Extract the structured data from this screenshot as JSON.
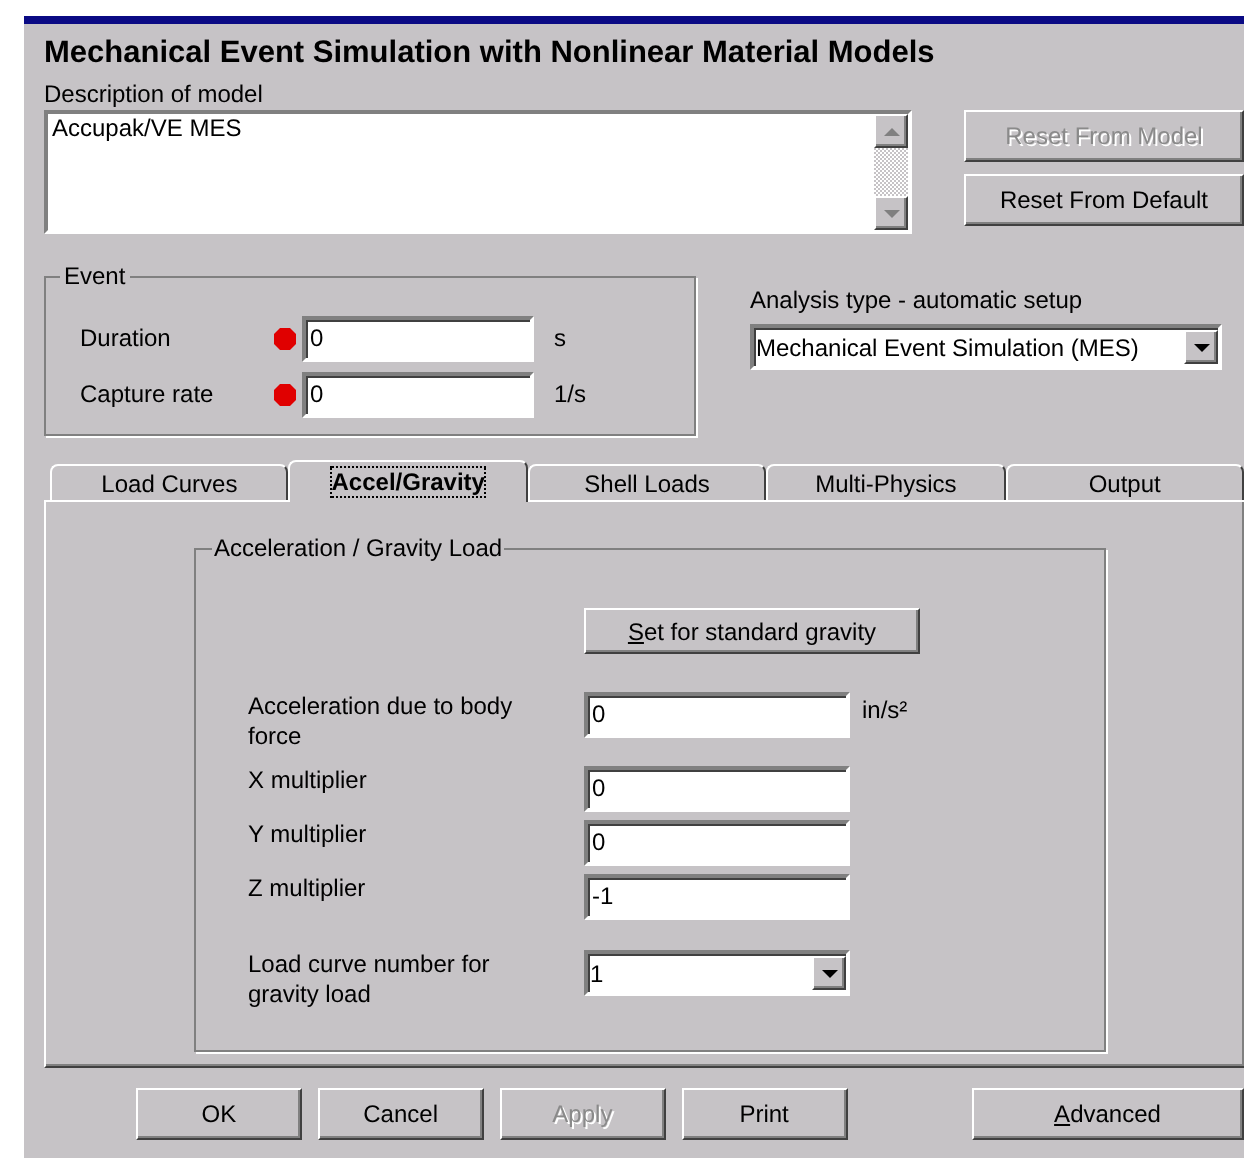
{
  "title": "Mechanical Event Simulation with Nonlinear Material Models",
  "description": {
    "label": "Description of model",
    "value": "Accupak/VE MES"
  },
  "side_buttons": [
    {
      "label": "Reset From Model",
      "disabled": true
    },
    {
      "label": "Reset From Default",
      "disabled": false
    }
  ],
  "event": {
    "title": "Event",
    "fields": [
      {
        "label": "Duration",
        "value": "0",
        "unit": "s",
        "required": true
      },
      {
        "label": "Capture rate",
        "value": "0",
        "unit": "1/s",
        "required": true
      }
    ]
  },
  "analysis": {
    "label": "Analysis type - automatic setup",
    "value": "Mechanical Event Simulation (MES)"
  },
  "tabs": [
    {
      "label": "Load Curves",
      "selected": false
    },
    {
      "label": "Accel/Gravity",
      "selected": true
    },
    {
      "label": "Shell Loads",
      "selected": false
    },
    {
      "label": "Multi-Physics",
      "selected": false
    },
    {
      "label": "Output",
      "selected": false
    }
  ],
  "gravity": {
    "title": "Acceleration / Gravity Load",
    "set_button": {
      "key": "S",
      "rest": "et for standard gravity"
    },
    "fields": [
      {
        "kind": "input",
        "label": "Acceleration due to body force",
        "value": "0",
        "unit": "in/s²"
      },
      {
        "kind": "input",
        "label": "X multiplier",
        "value": "0"
      },
      {
        "kind": "input",
        "label": "Y multiplier",
        "value": "0"
      },
      {
        "kind": "input",
        "label": "Z multiplier",
        "value": "-1"
      },
      {
        "kind": "dropdown",
        "label": "Load curve number for gravity load",
        "value": "1"
      }
    ]
  },
  "buttons": [
    {
      "label": "OK",
      "disabled": false
    },
    {
      "label": "Cancel",
      "disabled": false
    },
    {
      "label": "Apply",
      "disabled": true
    },
    {
      "label": "Print",
      "disabled": false
    },
    {
      "key": "A",
      "rest": "dvanced",
      "disabled": false
    }
  ]
}
